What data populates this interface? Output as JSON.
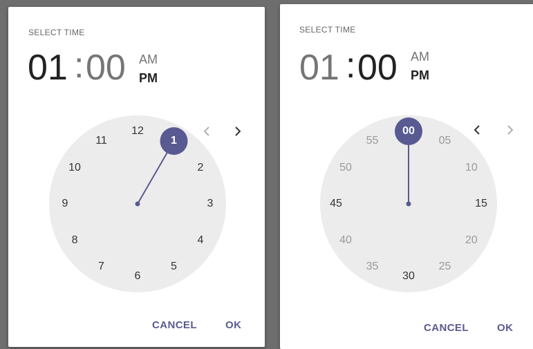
{
  "colors": {
    "accent": "#595a91",
    "dial": "#ececec",
    "active_text": "#222222",
    "inactive_text": "#757575"
  },
  "hours_dialog": {
    "label": "SELECT TIME",
    "hours": "01",
    "colon": ":",
    "minutes": "00",
    "am": "AM",
    "pm": "PM",
    "selected_period": "PM",
    "dial_numbers": [
      "12",
      "1",
      "2",
      "3",
      "4",
      "5",
      "6",
      "7",
      "8",
      "9",
      "10",
      "11"
    ],
    "selected": "1",
    "prev_icon": "chevron-left-icon",
    "next_icon": "chevron-right-icon",
    "cancel": "CANCEL",
    "ok": "OK"
  },
  "minutes_dialog": {
    "label": "SELECT TIME",
    "hours": "01",
    "colon": ":",
    "minutes": "00",
    "am": "AM",
    "pm": "PM",
    "selected_period": "PM",
    "dial_numbers": [
      "00",
      "05",
      "10",
      "15",
      "20",
      "25",
      "30",
      "35",
      "40",
      "45",
      "50",
      "55"
    ],
    "selected": "00",
    "prev_icon": "chevron-left-icon",
    "next_icon": "chevron-right-icon",
    "cancel": "CANCEL",
    "ok": "OK"
  }
}
